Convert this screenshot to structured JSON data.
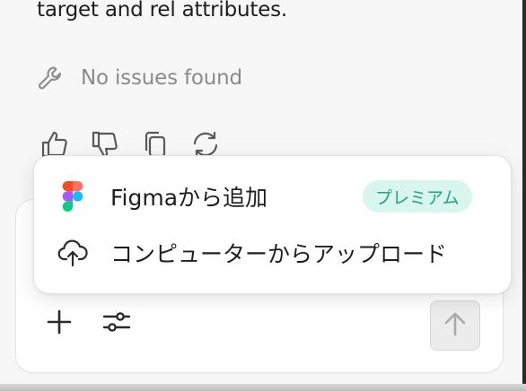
{
  "message": {
    "text": "target and rel attributes."
  },
  "notice": {
    "icon": "wrench-icon",
    "text": "No issues found"
  },
  "feedback": {
    "icons": [
      "thumbs-up-icon",
      "thumbs-down-icon",
      "copy-icon",
      "regenerate-icon"
    ]
  },
  "menu": {
    "items": [
      {
        "label": "Figmaから追加",
        "icon": "figma-icon",
        "badge": "プレミアム"
      },
      {
        "label": "コンピューターからアップロード",
        "icon": "cloud-upload-icon"
      }
    ]
  },
  "composer": {
    "tools": [
      "plus-icon",
      "sliders-icon"
    ],
    "send_icon": "arrow-up-icon"
  },
  "colors": {
    "badge_bg": "#d8f5ee",
    "badge_text": "#23a383",
    "muted_text": "#8a8a8a"
  }
}
